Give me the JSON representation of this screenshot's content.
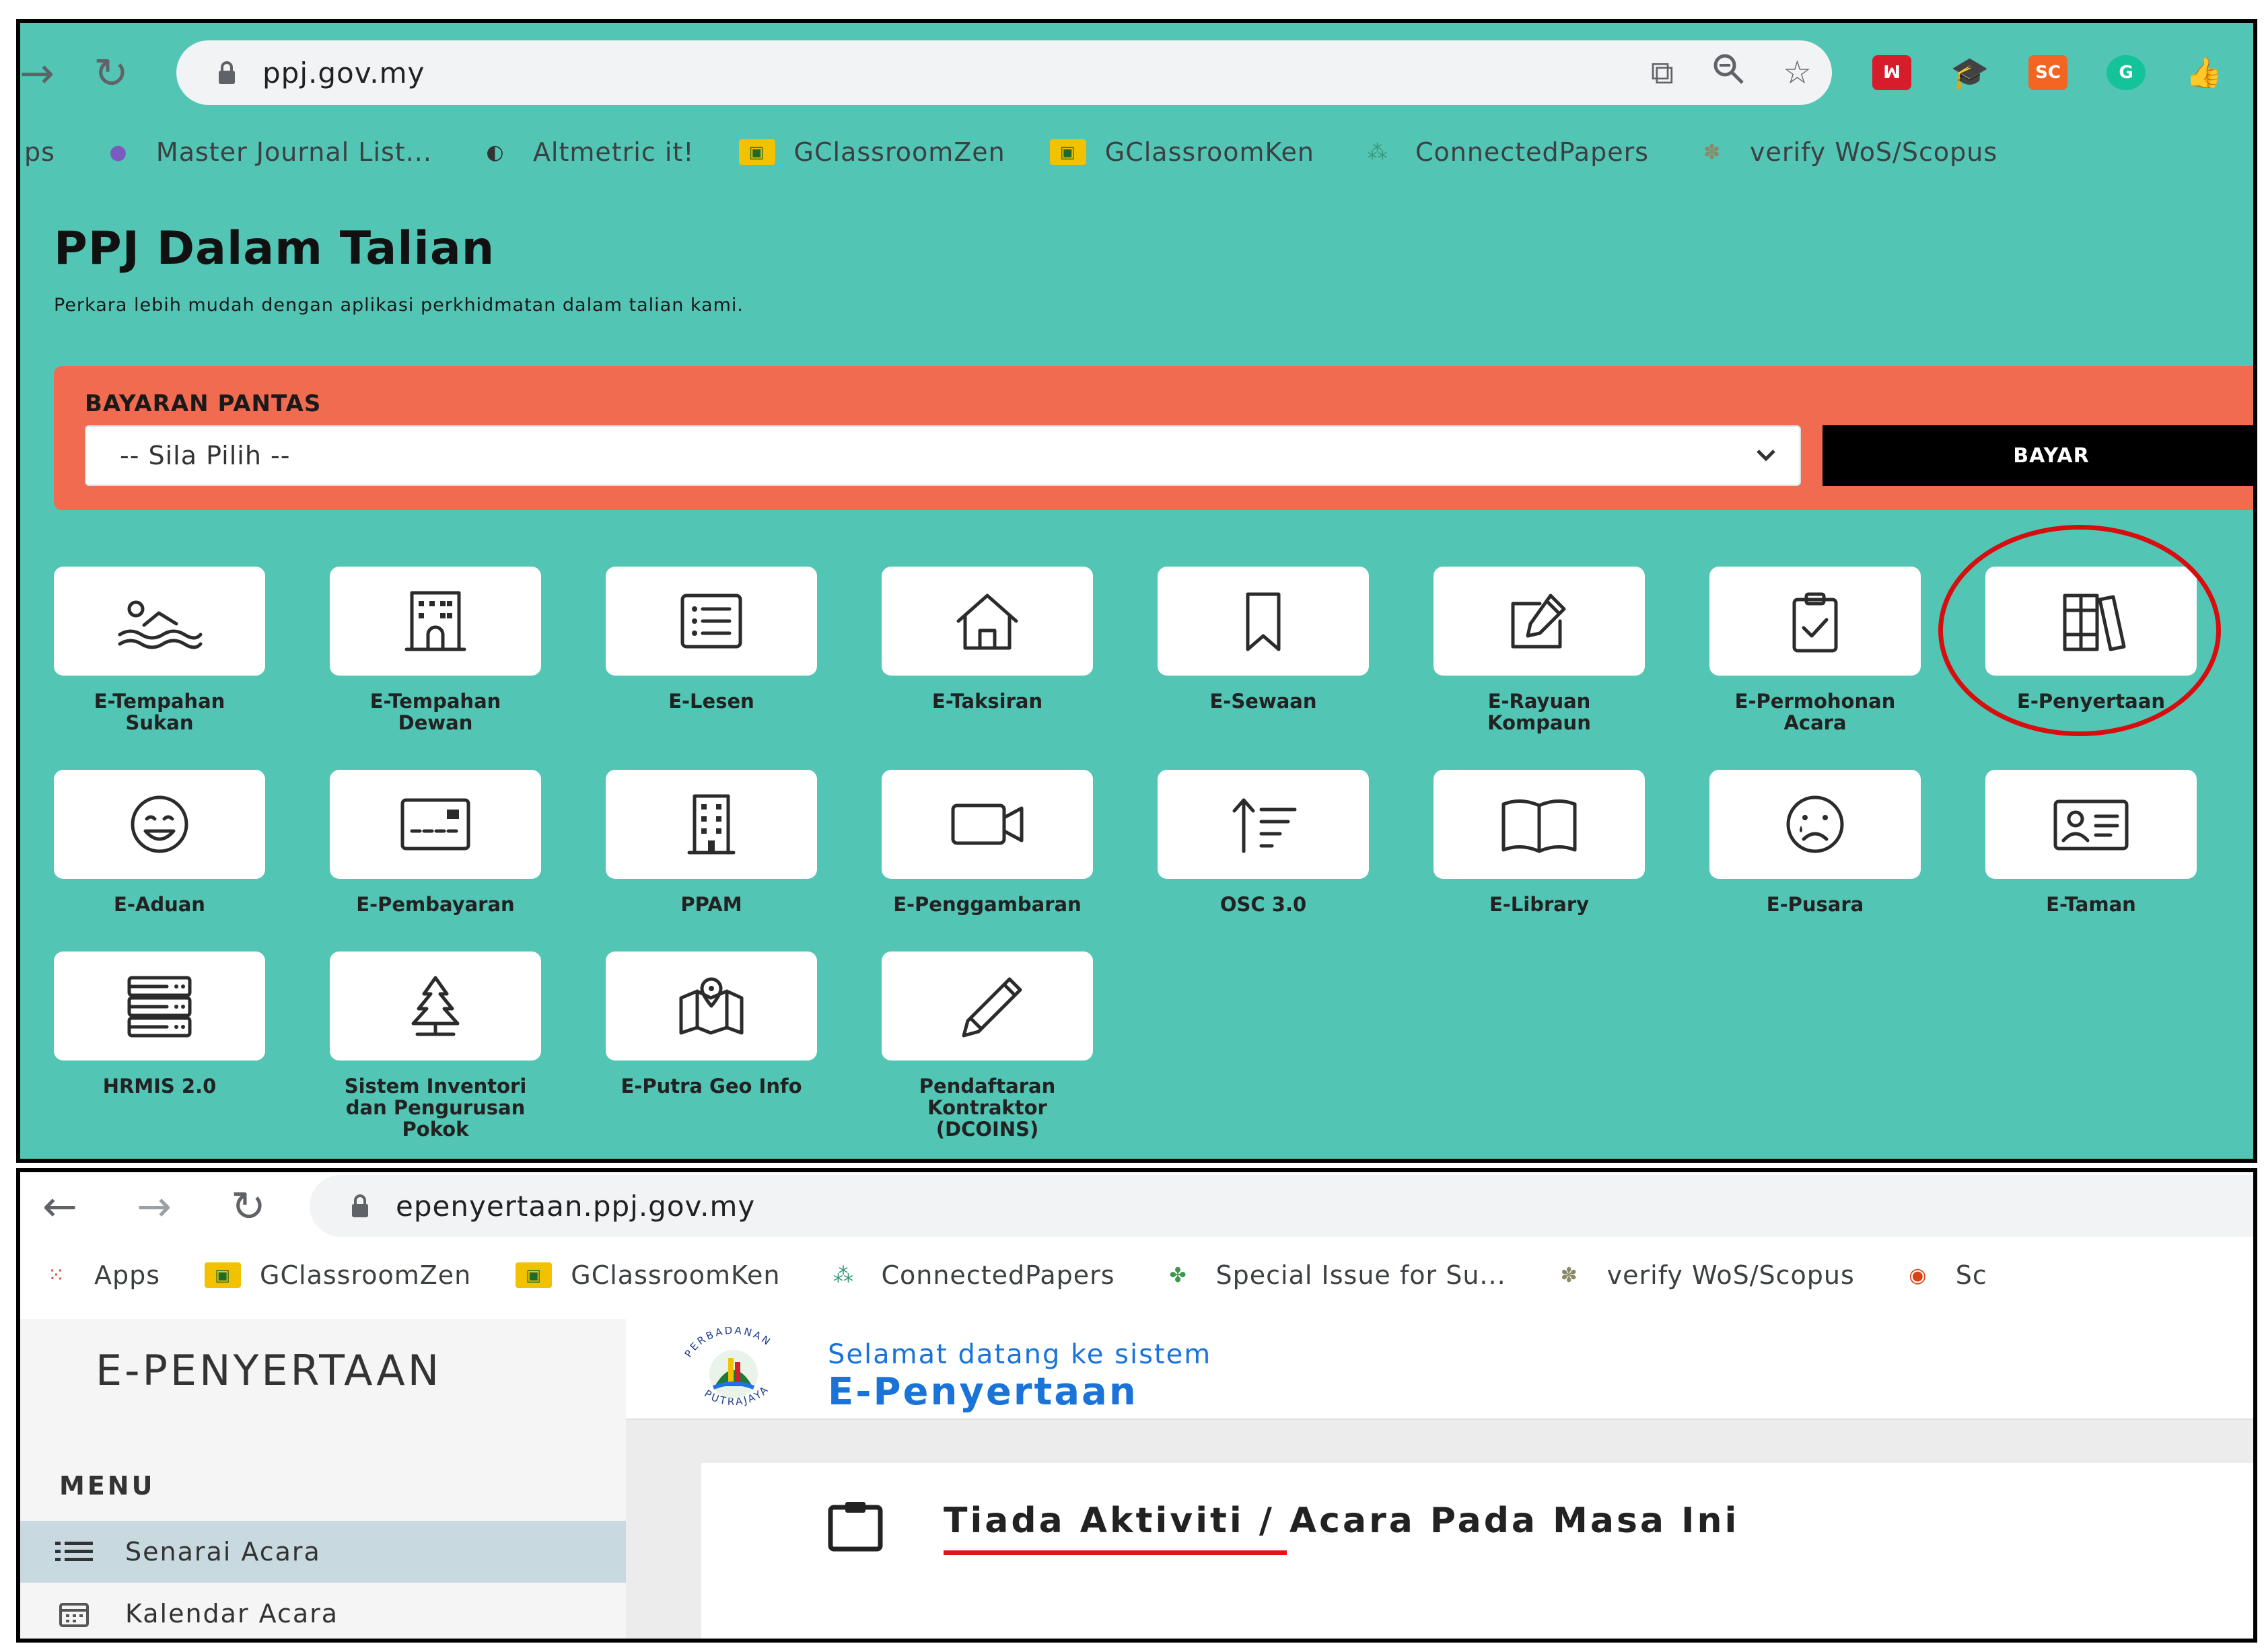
{
  "panel_top": {
    "browser": {
      "url": "ppj.gov.my",
      "bookmarks": [
        {
          "label": "ps",
          "icon": "apps-icon"
        },
        {
          "label": "Master Journal List...",
          "icon": "journal-icon"
        },
        {
          "label": "Altmetric it!",
          "icon": "altmetric-icon"
        },
        {
          "label": "GClassroomZen",
          "icon": "google-classroom-icon"
        },
        {
          "label": "GClassroomKen",
          "icon": "google-classroom-icon"
        },
        {
          "label": "ConnectedPapers",
          "icon": "connected-papers-icon"
        },
        {
          "label": "verify WoS/Scopus",
          "icon": "tree-icon"
        }
      ],
      "extensions": [
        {
          "name": "mendeley-icon",
          "text": "",
          "color": "#d71c2b"
        },
        {
          "name": "graduation-cap-icon",
          "text": "",
          "color": "#1e73e8"
        },
        {
          "name": "scite-icon",
          "text": "SC",
          "color": "#f26522"
        },
        {
          "name": "grammarly-icon",
          "text": "G",
          "color": "#15c39a"
        },
        {
          "name": "thumbs-up-icon",
          "text": "",
          "color": "#f6b800"
        }
      ]
    },
    "portal": {
      "title": "PPJ Dalam Talian",
      "subtitle": "Perkara lebih mudah dengan aplikasi perkhidmatan dalam talian kami.",
      "quick_pay": {
        "label": "BAYARAN PANTAS",
        "select_value": "-- Sila Pilih --",
        "button": "BAYAR"
      },
      "services": [
        {
          "label": "E-Tempahan Sukan",
          "icon": "swimmer-icon"
        },
        {
          "label": "E-Tempahan Dewan",
          "icon": "hall-building-icon"
        },
        {
          "label": "E-Lesen",
          "icon": "list-icon"
        },
        {
          "label": "E-Taksiran",
          "icon": "house-icon"
        },
        {
          "label": "E-Sewaan",
          "icon": "bookmark-icon"
        },
        {
          "label": "E-Rayuan Kompaun",
          "icon": "edit-icon"
        },
        {
          "label": "E-Permohonan Acara",
          "icon": "clipboard-check-icon"
        },
        {
          "label": "E-Penyertaan",
          "icon": "books-icon"
        },
        {
          "label": "E-Aduan",
          "icon": "smile-icon"
        },
        {
          "label": "E-Pembayaran",
          "icon": "card-icon"
        },
        {
          "label": "PPAM",
          "icon": "office-building-icon"
        },
        {
          "label": "E-Penggambaran",
          "icon": "video-camera-icon"
        },
        {
          "label": "OSC 3.0",
          "icon": "sort-icon"
        },
        {
          "label": "E-Library",
          "icon": "open-book-icon"
        },
        {
          "label": "E-Pusara",
          "icon": "sad-face-icon"
        },
        {
          "label": "E-Taman",
          "icon": "id-card-icon"
        },
        {
          "label": "HRMIS 2.0",
          "icon": "server-icon"
        },
        {
          "label": "Sistem Inventori dan Pengurusan Pokok",
          "icon": "pine-tree-icon"
        },
        {
          "label": "E-Putra Geo Info",
          "icon": "map-pin-icon"
        },
        {
          "label": "Pendaftaran Kontraktor (DCOINS)",
          "icon": "pen-icon"
        }
      ]
    }
  },
  "panel_bottom": {
    "browser": {
      "url": "epenyertaan.ppj.gov.my",
      "bookmarks": [
        {
          "label": "Apps",
          "icon": "apps-grid-icon"
        },
        {
          "label": "GClassroomZen",
          "icon": "google-classroom-icon"
        },
        {
          "label": "GClassroomKen",
          "icon": "google-classroom-icon"
        },
        {
          "label": "ConnectedPapers",
          "icon": "connected-papers-icon"
        },
        {
          "label": "Special Issue for Su...",
          "icon": "plant-icon"
        },
        {
          "label": "verify WoS/Scopus",
          "icon": "tree-icon"
        },
        {
          "label": "Sc",
          "icon": "eye-icon"
        }
      ]
    },
    "app": {
      "brand": "E-PENYERTAAN",
      "menu_title": "MENU",
      "menu": [
        {
          "label": "Senarai Acara",
          "icon": "list-icon",
          "active": true
        },
        {
          "label": "Kalendar Acara",
          "icon": "calendar-icon",
          "active": false
        }
      ],
      "welcome": "Selamat datang ke sistem",
      "system_name": "E-Penyertaan",
      "logo_text": "PERBADANAN PUTRAJAYA",
      "message": "Tiada Aktiviti / Acara Pada Masa Ini"
    }
  }
}
